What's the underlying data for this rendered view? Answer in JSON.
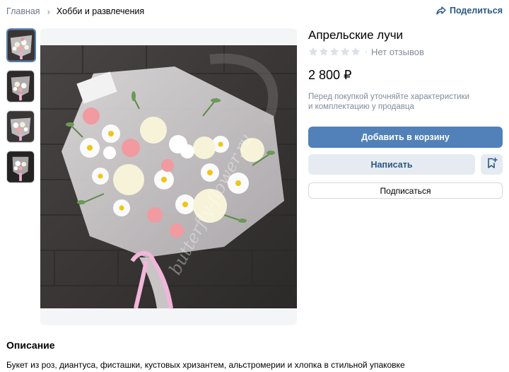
{
  "breadcrumb": {
    "home": "Главная",
    "separator": "›",
    "current": "Хобби и развлечения"
  },
  "share": {
    "label": "Поделиться",
    "icon": "share-icon"
  },
  "thumbnails": [
    {
      "icon": "bouquet-thumbnail",
      "active": true
    },
    {
      "icon": "bouquet-thumbnail",
      "active": false
    },
    {
      "icon": "bouquet-thumbnail",
      "active": false
    },
    {
      "icon": "bouquet-thumbnail",
      "active": false
    }
  ],
  "photo": {
    "watermark": "butterfly-flower.ru"
  },
  "product": {
    "title": "Апрельские лучи",
    "rating_stars": 0,
    "rating_max": 5,
    "reviews": "Нет отзывов",
    "price": "2 800 ₽",
    "note_line1": "Перед покупкой уточняйте характеристики",
    "note_line2": "и комплектацию у продавца"
  },
  "actions": {
    "add_to_cart": "Добавить в корзину",
    "write": "Написать",
    "bookmark_icon": "bookmark-add-icon",
    "subscribe": "Подписаться"
  },
  "description": {
    "title": "Описание",
    "text": "Букет из роз, диантуса, фисташки, кустовых хризантем, альстромерии и хлопка в стильной упаковке"
  },
  "colors": {
    "accent": "#5181b8",
    "link": "#2a5885",
    "secondary_bg": "#e5ebf1",
    "muted": "#818c99"
  }
}
